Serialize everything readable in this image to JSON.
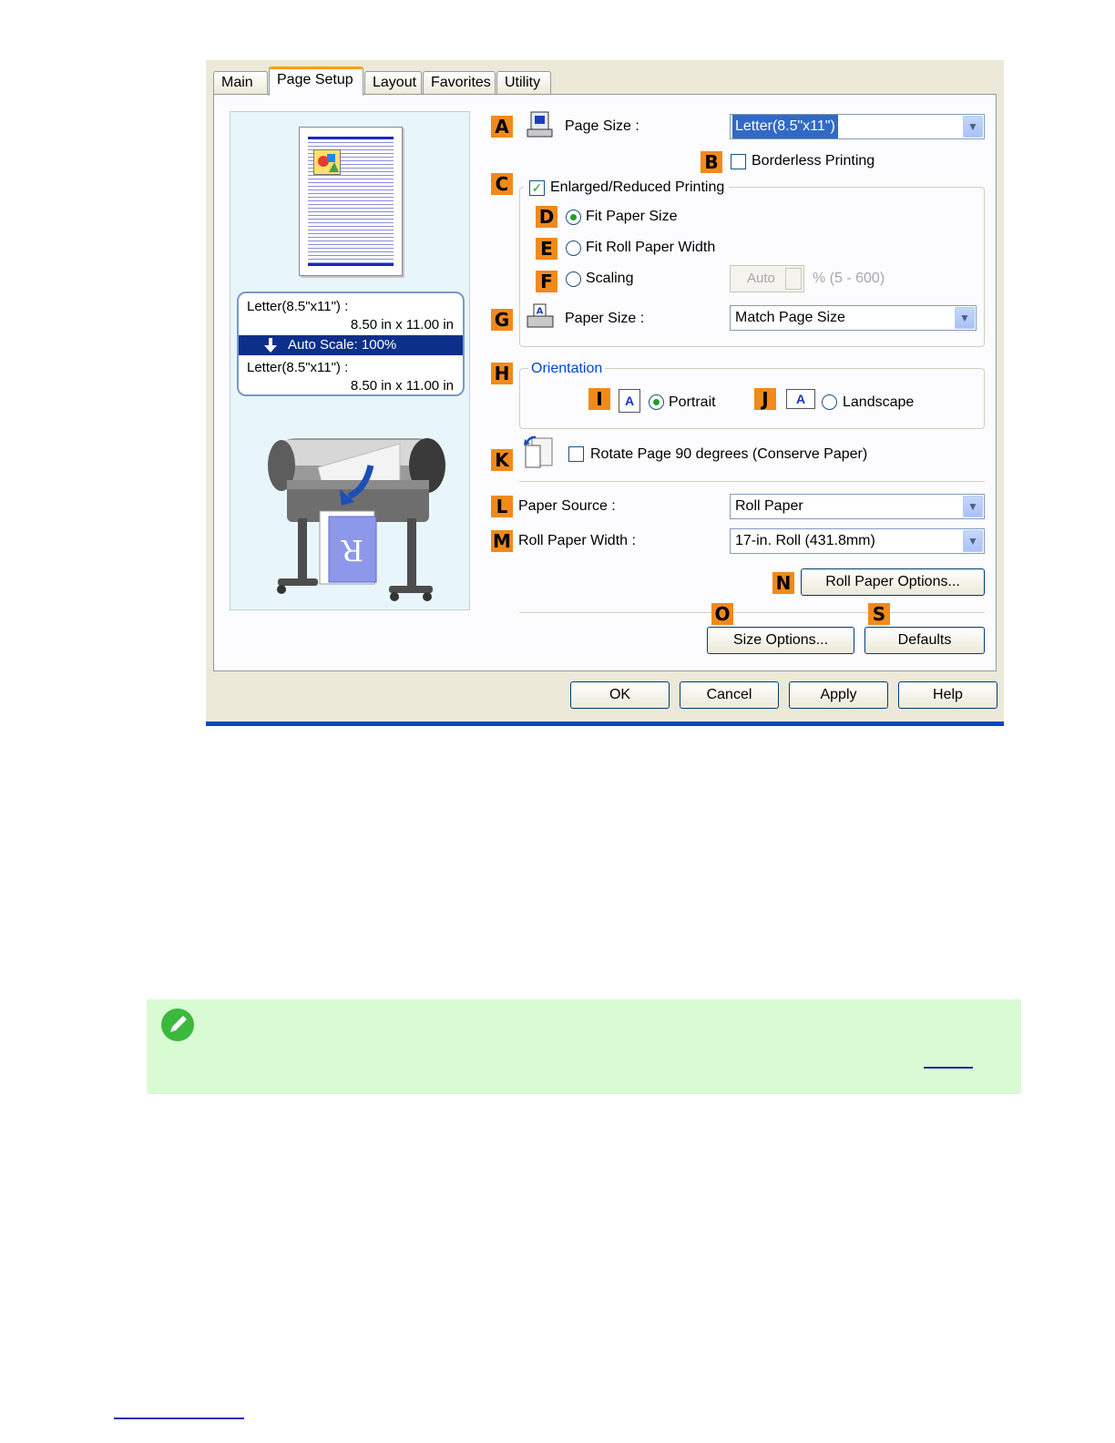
{
  "dialog": {
    "tabs": [
      "Main",
      "Page Setup",
      "Layout",
      "Favorites",
      "Utility"
    ],
    "active_tab": "Page Setup",
    "buttons": {
      "ok": "OK",
      "cancel": "Cancel",
      "apply": "Apply",
      "help": "Help"
    }
  },
  "preview": {
    "input_size": "Letter(8.5\"x11\") :",
    "input_dims": "8.50 in x 11.00 in",
    "scale": "Auto Scale: 100%",
    "output_size": "Letter(8.5\"x11\") :",
    "output_dims": "8.50 in x 11.00 in"
  },
  "badges": {
    "A": "A",
    "B": "B",
    "C": "C",
    "D": "D",
    "E": "E",
    "F": "F",
    "G": "G",
    "H": "H",
    "I": "I",
    "J": "J",
    "K": "K",
    "L": "L",
    "M": "M",
    "N": "N",
    "O": "O",
    "S": "S"
  },
  "page_setup": {
    "page_size_label": "Page Size :",
    "page_size_value": "Letter(8.5\"x11\")",
    "borderless_label": "Borderless Printing",
    "borderless_checked": false,
    "enlarged_label": "Enlarged/Reduced Printing",
    "enlarged_checked": true,
    "fit_paper_label": "Fit Paper Size",
    "fit_roll_label": "Fit Roll Paper Width",
    "scaling_label": "Scaling",
    "scaling_value": "Auto",
    "scaling_range": "% (5 - 600)",
    "selected_fit_option": "Fit Paper Size",
    "paper_size_label": "Paper Size :",
    "paper_size_value": "Match Page Size",
    "orientation_title": "Orientation",
    "portrait_label": "Portrait",
    "landscape_label": "Landscape",
    "orientation_selected": "Portrait",
    "orient_icon_glyph": "A",
    "rotate_label": "Rotate Page 90 degrees (Conserve Paper)",
    "rotate_checked": false,
    "paper_source_label": "Paper Source :",
    "paper_source_value": "Roll Paper",
    "roll_width_label": "Roll Paper Width :",
    "roll_width_value": "17-in. Roll (431.8mm)",
    "roll_options_btn": "Roll Paper Options...",
    "size_options_btn": "Size Options...",
    "defaults_btn": "Defaults"
  },
  "colors": {
    "badge": "#f18a1b",
    "accent_blue": "#0a46c8",
    "note_bg": "#d9fbd3"
  }
}
